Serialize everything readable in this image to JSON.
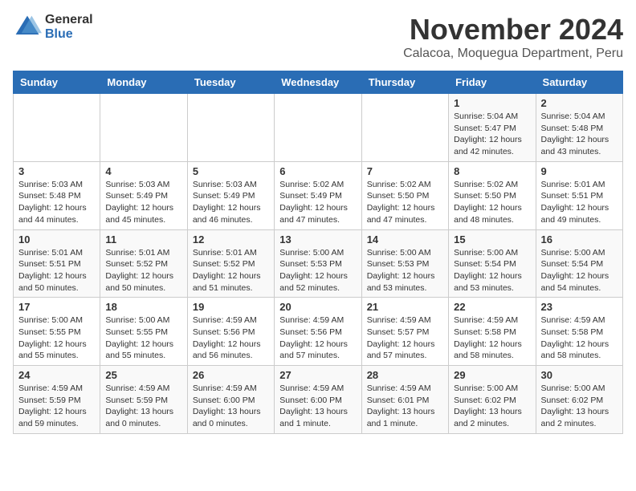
{
  "logo": {
    "general": "General",
    "blue": "Blue"
  },
  "title": "November 2024",
  "subtitle": "Calacoa, Moquegua Department, Peru",
  "weekdays": [
    "Sunday",
    "Monday",
    "Tuesday",
    "Wednesday",
    "Thursday",
    "Friday",
    "Saturday"
  ],
  "weeks": [
    [
      {
        "day": "",
        "info": ""
      },
      {
        "day": "",
        "info": ""
      },
      {
        "day": "",
        "info": ""
      },
      {
        "day": "",
        "info": ""
      },
      {
        "day": "",
        "info": ""
      },
      {
        "day": "1",
        "info": "Sunrise: 5:04 AM\nSunset: 5:47 PM\nDaylight: 12 hours\nand 42 minutes."
      },
      {
        "day": "2",
        "info": "Sunrise: 5:04 AM\nSunset: 5:48 PM\nDaylight: 12 hours\nand 43 minutes."
      }
    ],
    [
      {
        "day": "3",
        "info": "Sunrise: 5:03 AM\nSunset: 5:48 PM\nDaylight: 12 hours\nand 44 minutes."
      },
      {
        "day": "4",
        "info": "Sunrise: 5:03 AM\nSunset: 5:49 PM\nDaylight: 12 hours\nand 45 minutes."
      },
      {
        "day": "5",
        "info": "Sunrise: 5:03 AM\nSunset: 5:49 PM\nDaylight: 12 hours\nand 46 minutes."
      },
      {
        "day": "6",
        "info": "Sunrise: 5:02 AM\nSunset: 5:49 PM\nDaylight: 12 hours\nand 47 minutes."
      },
      {
        "day": "7",
        "info": "Sunrise: 5:02 AM\nSunset: 5:50 PM\nDaylight: 12 hours\nand 47 minutes."
      },
      {
        "day": "8",
        "info": "Sunrise: 5:02 AM\nSunset: 5:50 PM\nDaylight: 12 hours\nand 48 minutes."
      },
      {
        "day": "9",
        "info": "Sunrise: 5:01 AM\nSunset: 5:51 PM\nDaylight: 12 hours\nand 49 minutes."
      }
    ],
    [
      {
        "day": "10",
        "info": "Sunrise: 5:01 AM\nSunset: 5:51 PM\nDaylight: 12 hours\nand 50 minutes."
      },
      {
        "day": "11",
        "info": "Sunrise: 5:01 AM\nSunset: 5:52 PM\nDaylight: 12 hours\nand 50 minutes."
      },
      {
        "day": "12",
        "info": "Sunrise: 5:01 AM\nSunset: 5:52 PM\nDaylight: 12 hours\nand 51 minutes."
      },
      {
        "day": "13",
        "info": "Sunrise: 5:00 AM\nSunset: 5:53 PM\nDaylight: 12 hours\nand 52 minutes."
      },
      {
        "day": "14",
        "info": "Sunrise: 5:00 AM\nSunset: 5:53 PM\nDaylight: 12 hours\nand 53 minutes."
      },
      {
        "day": "15",
        "info": "Sunrise: 5:00 AM\nSunset: 5:54 PM\nDaylight: 12 hours\nand 53 minutes."
      },
      {
        "day": "16",
        "info": "Sunrise: 5:00 AM\nSunset: 5:54 PM\nDaylight: 12 hours\nand 54 minutes."
      }
    ],
    [
      {
        "day": "17",
        "info": "Sunrise: 5:00 AM\nSunset: 5:55 PM\nDaylight: 12 hours\nand 55 minutes."
      },
      {
        "day": "18",
        "info": "Sunrise: 5:00 AM\nSunset: 5:55 PM\nDaylight: 12 hours\nand 55 minutes."
      },
      {
        "day": "19",
        "info": "Sunrise: 4:59 AM\nSunset: 5:56 PM\nDaylight: 12 hours\nand 56 minutes."
      },
      {
        "day": "20",
        "info": "Sunrise: 4:59 AM\nSunset: 5:56 PM\nDaylight: 12 hours\nand 57 minutes."
      },
      {
        "day": "21",
        "info": "Sunrise: 4:59 AM\nSunset: 5:57 PM\nDaylight: 12 hours\nand 57 minutes."
      },
      {
        "day": "22",
        "info": "Sunrise: 4:59 AM\nSunset: 5:58 PM\nDaylight: 12 hours\nand 58 minutes."
      },
      {
        "day": "23",
        "info": "Sunrise: 4:59 AM\nSunset: 5:58 PM\nDaylight: 12 hours\nand 58 minutes."
      }
    ],
    [
      {
        "day": "24",
        "info": "Sunrise: 4:59 AM\nSunset: 5:59 PM\nDaylight: 12 hours\nand 59 minutes."
      },
      {
        "day": "25",
        "info": "Sunrise: 4:59 AM\nSunset: 5:59 PM\nDaylight: 13 hours\nand 0 minutes."
      },
      {
        "day": "26",
        "info": "Sunrise: 4:59 AM\nSunset: 6:00 PM\nDaylight: 13 hours\nand 0 minutes."
      },
      {
        "day": "27",
        "info": "Sunrise: 4:59 AM\nSunset: 6:00 PM\nDaylight: 13 hours\nand 1 minute."
      },
      {
        "day": "28",
        "info": "Sunrise: 4:59 AM\nSunset: 6:01 PM\nDaylight: 13 hours\nand 1 minute."
      },
      {
        "day": "29",
        "info": "Sunrise: 5:00 AM\nSunset: 6:02 PM\nDaylight: 13 hours\nand 2 minutes."
      },
      {
        "day": "30",
        "info": "Sunrise: 5:00 AM\nSunset: 6:02 PM\nDaylight: 13 hours\nand 2 minutes."
      }
    ]
  ]
}
